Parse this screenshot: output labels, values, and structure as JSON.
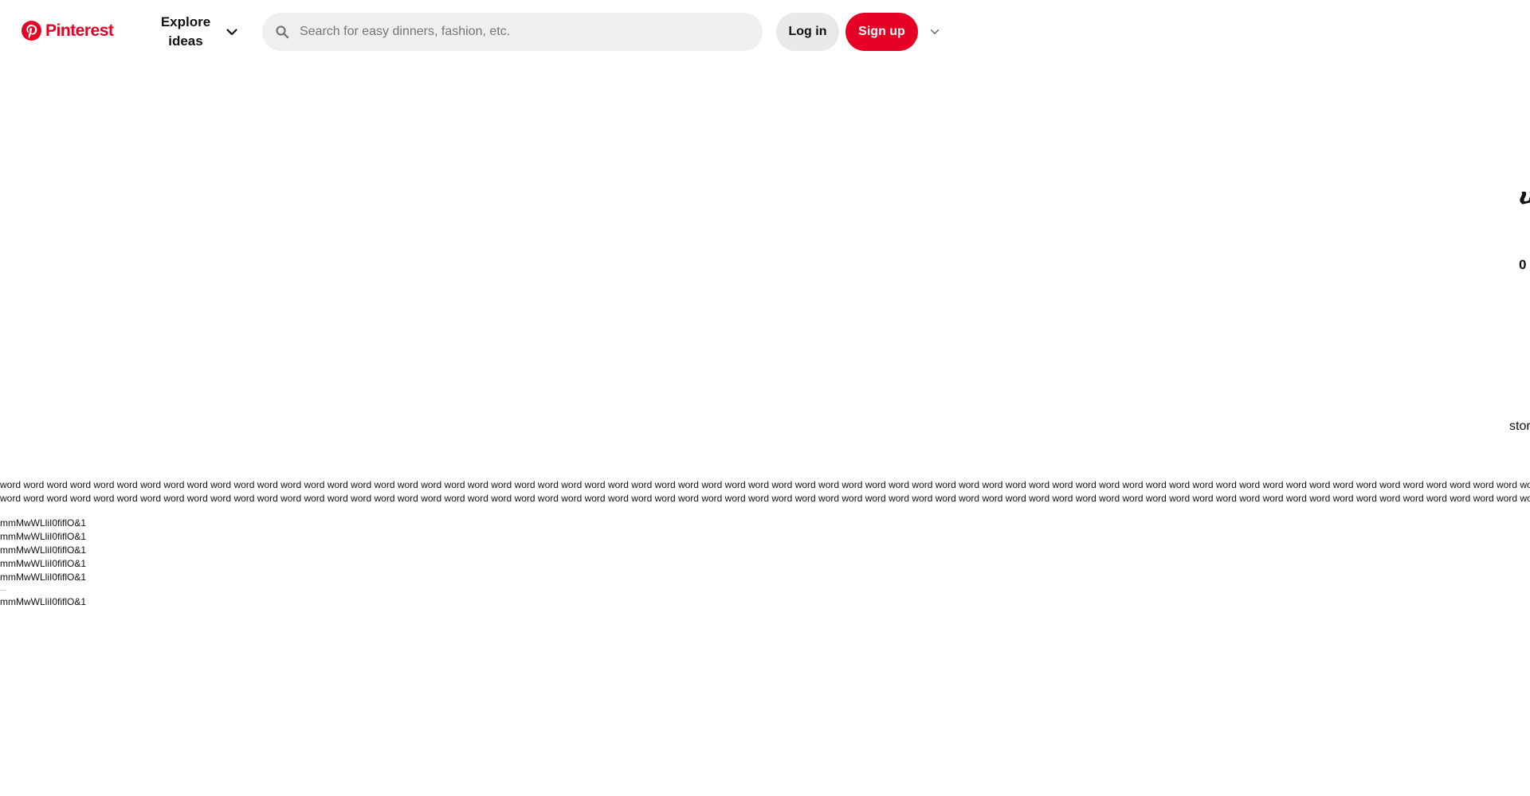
{
  "brand": {
    "name": "Pinterest",
    "color": "#e60023"
  },
  "header": {
    "explore_label": "Explore ideas",
    "search_placeholder": "Search for easy dinners, fashion, etc.",
    "login_label": "Log in",
    "signup_label": "Sign up",
    "icons": [
      "pinterest-logo-icon",
      "chevron-down-icon",
      "search-icon"
    ]
  },
  "content": {
    "edge_glyph": "ሠ",
    "edge_count": "0",
    "edge_store": "stor",
    "word_line_1": "word word word word word word word word word word word word word word word word word word word word word word word word word word word word word word word word word word word word word word word word word word word word word word word word word word word word word word word word word word word word word word word word word word w",
    "word_line_2": "word word word word word word word word word word word word word word word word word word word word word word word word word word word word word word word word word word word word word word word word word word word word word word word word word word word word word word word word word word word word word word word word word word w",
    "glyph_lines": [
      "mmMwWLliI0fiflO&1",
      "mmMwWLliI0fiflO&1",
      "mmMwWLliI0fiflO&1",
      "mmMwWLliI0fiflO&1",
      "mmMwWLliI0fiflO&1"
    ],
    "glyph_line_after_divider": "mmMwWLliI0fiflO&1"
  }
}
